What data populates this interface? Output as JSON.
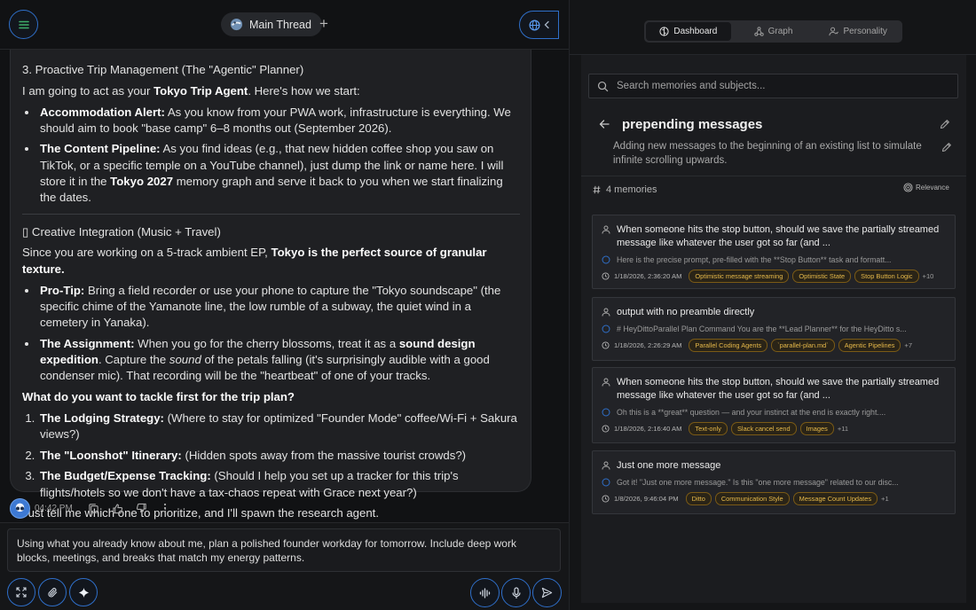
{
  "header": {
    "thread_label": "Main Thread",
    "new_thread_label": "+"
  },
  "message": {
    "section_heading": "3. Proactive Trip Management (The \"Agentic\" Planner)",
    "intro_prefix": "I am going to act as your ",
    "intro_bold": "Tokyo Trip Agent",
    "intro_suffix": ". Here's how we start:",
    "bullets1": [
      {
        "bold": "Accommodation Alert:",
        "text": " As you know from your PWA work, infrastructure is everything. We should aim to book \"base camp\" 6–8 months out (September 2026)."
      },
      {
        "bold": "The Content Pipeline:",
        "text": " As you find ideas (e.g., that new hidden coffee shop you saw on TikTok, or a specific temple on a YouTube channel), just dump the link or name here. I will store it in the ",
        "bold2": "Tokyo 2027",
        "text2": " memory graph and serve it back to you when we start finalizing the dates."
      }
    ],
    "section2_heading": "▯ Creative Integration (Music + Travel)",
    "section2_prefix": "Since you are working on a 5-track ambient EP, ",
    "section2_bold": "Tokyo is the perfect source of granular texture.",
    "bullets2": [
      {
        "bold": "Pro-Tip:",
        "text": " Bring a field recorder or use your phone to capture the \"Tokyo soundscape\" (the specific chime of the Yamanote line, the low rumble of a subway, the quiet wind in a cemetery in Yanaka)."
      },
      {
        "bold": "The Assignment:",
        "text": " When you go for the cherry blossoms, treat it as a ",
        "bold2": "sound design expedition",
        "text2": ". Capture the ",
        "italic": "sound",
        "text3": " of the petals falling (it's surprisingly audible with a good condenser mic). That recording will be the \"heartbeat\" of one of your tracks."
      }
    ],
    "question": "What do you want to tackle first for the trip plan?",
    "options": [
      {
        "bold": "The Lodging Strategy:",
        "text": " (Where to stay for optimized \"Founder Mode\" coffee/Wi-Fi + Sakura views?)"
      },
      {
        "bold": "The \"Loonshot\" Itinerary:",
        "text": " (Hidden spots away from the massive tourist crowds?)"
      },
      {
        "bold": "The Budget/Expense Tracking:",
        "text": " (Should I help you set up a tracker for this trip's flights/hotels so we don't have a tax-chaos repeat with Grace next year?)"
      }
    ],
    "closing": "Just tell me which one to prioritize, and I'll spawn the research agent.",
    "time": "04:42 PM"
  },
  "composer": {
    "text": "Using what you already know about me, plan a polished founder workday for tomorrow. Include deep work blocks, meetings, and breaks that match my energy patterns."
  },
  "right_panel": {
    "tabs": [
      {
        "label": "Dashboard",
        "icon": "brain-icon",
        "active": true
      },
      {
        "label": "Graph",
        "icon": "graph-icon",
        "active": false
      },
      {
        "label": "Personality",
        "icon": "person-icon",
        "active": false
      }
    ],
    "search_placeholder": "Search memories and subjects...",
    "subject": {
      "title": "prepending messages",
      "description": "Adding new messages to the beginning of an existing list to simulate infinite scrolling upwards."
    },
    "memory_count": "4 memories",
    "sort_label": "Relevance",
    "memories": [
      {
        "title": "When someone hits the stop button, should we save the partially streamed message like whatever the user got so far (and ...",
        "snippet": "Here is the precise prompt, pre-filled with the **Stop Button** task and formatt...",
        "date": "1/18/2026, 2:36:20 AM",
        "tags": [
          "Optimistic message streaming",
          "Optimistic State",
          "Stop Button Logic"
        ],
        "more": "+10"
      },
      {
        "title": "output with no preamble directly",
        "snippet": "# HeyDittoParallel Plan Command You are the **Lead Planner** for the HeyDitto s...",
        "date": "1/18/2026, 2:26:29 AM",
        "tags": [
          "Parallel Coding Agents",
          "`parallel-plan.md`",
          "Agentic Pipelines"
        ],
        "more": "+7"
      },
      {
        "title": "When someone hits the stop button, should we save the partially streamed message like whatever the user got so far (and ...",
        "snippet": "Oh this is a **great** question — and your instinct at the end is exactly right....",
        "date": "1/18/2026, 2:16:40 AM",
        "tags": [
          "Text-only",
          "Slack cancel send",
          "Images"
        ],
        "more": "+11"
      },
      {
        "title": "Just one more message",
        "snippet": "Got it! \"Just one more message.\" Is this \"one more message\" related to our disc...",
        "date": "1/8/2026, 9:46:04 PM",
        "tags": [
          "Ditto",
          "Communication Style",
          "Message Count Updates"
        ],
        "more": "+1"
      }
    ]
  },
  "colors": {
    "accent": "#2f6fc9",
    "tag_text": "#e6b94a",
    "tag_border": "#7a5a16"
  }
}
